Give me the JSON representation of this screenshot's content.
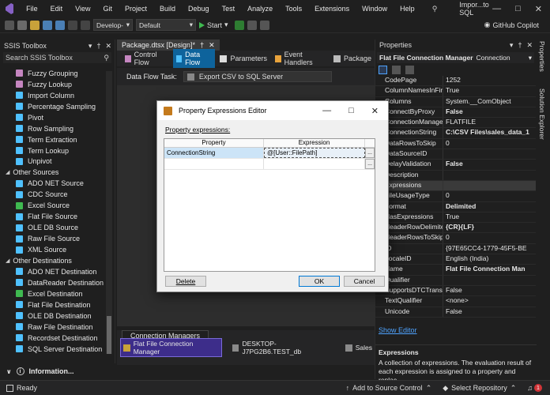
{
  "menu": [
    "File",
    "Edit",
    "View",
    "Git",
    "Project",
    "Build",
    "Debug",
    "Test",
    "Analyze",
    "Tools",
    "Extensions",
    "Window",
    "Help"
  ],
  "window_title": "Impor...to SQL",
  "toolbar": {
    "config": "Develop‑",
    "platform": "Default",
    "start": "Start",
    "copilot": "GitHub Copilot"
  },
  "toolbox": {
    "title": "SSIS Toolbox",
    "search": "Search SSIS Toolbox",
    "top_items": [
      {
        "label": "Fuzzy Grouping",
        "color": "#c586c0"
      },
      {
        "label": "Fuzzy Lookup",
        "color": "#c586c0"
      },
      {
        "label": "Import Column",
        "color": "#4fc1ff"
      },
      {
        "label": "Percentage Sampling",
        "color": "#4fc1ff"
      },
      {
        "label": "Pivot",
        "color": "#4fc1ff"
      },
      {
        "label": "Row Sampling",
        "color": "#4fc1ff"
      },
      {
        "label": "Term Extraction",
        "color": "#4fc1ff"
      },
      {
        "label": "Term Lookup",
        "color": "#4fc1ff"
      },
      {
        "label": "Unpivot",
        "color": "#4fc1ff"
      }
    ],
    "sources_header": "Other Sources",
    "sources": [
      {
        "label": "ADO NET Source",
        "color": "#4fc1ff"
      },
      {
        "label": "CDC Source",
        "color": "#4fc1ff"
      },
      {
        "label": "Excel Source",
        "color": "#3fb950"
      },
      {
        "label": "Flat File Source",
        "color": "#4fc1ff"
      },
      {
        "label": "OLE DB Source",
        "color": "#4fc1ff"
      },
      {
        "label": "Raw File Source",
        "color": "#4fc1ff"
      },
      {
        "label": "XML Source",
        "color": "#4fc1ff"
      }
    ],
    "dest_header": "Other Destinations",
    "destinations": [
      {
        "label": "ADO NET Destination",
        "color": "#4fc1ff"
      },
      {
        "label": "DataReader Destination",
        "color": "#4fc1ff"
      },
      {
        "label": "Excel Destination",
        "color": "#3fb950"
      },
      {
        "label": "Flat File Destination",
        "color": "#4fc1ff"
      },
      {
        "label": "OLE DB Destination",
        "color": "#4fc1ff"
      },
      {
        "label": "Raw File Destination",
        "color": "#4fc1ff"
      },
      {
        "label": "Recordset Destination",
        "color": "#4fc1ff"
      },
      {
        "label": "SQL Server Destination",
        "color": "#4fc1ff"
      }
    ],
    "info": "Information..."
  },
  "designer": {
    "doc_tab": "Package.dtsx [Design]*",
    "tabs": [
      {
        "label": "Control Flow",
        "active": false
      },
      {
        "label": "Data Flow",
        "active": true
      },
      {
        "label": "Parameters",
        "active": false
      },
      {
        "label": "Event Handlers",
        "active": false
      },
      {
        "label": "Package",
        "active": false
      }
    ],
    "task_label": "Data Flow Task:",
    "task_value": "Export CSV to SQL Server",
    "conn_tab": "Connection Managers",
    "conns": [
      {
        "label": "Flat File Connection Manager",
        "selected": true
      },
      {
        "label": "DESKTOP-J7PG2B6.TEST_db",
        "selected": false
      },
      {
        "label": "Sales",
        "selected": false
      }
    ]
  },
  "properties": {
    "title": "Properties",
    "object_name": "Flat File Connection Manager",
    "object_type": "Connection",
    "rows": [
      {
        "name": "CodePage",
        "value": "1252",
        "bold": false
      },
      {
        "name": "ColumnNamesInFirstD",
        "value": "True",
        "bold": false
      },
      {
        "name": "Columns",
        "value": "System.__ComObject",
        "bold": false
      },
      {
        "name": "ConnectByProxy",
        "value": "False",
        "bold": true
      },
      {
        "name": "ConnectionManagerTy",
        "value": "FLATFILE",
        "bold": false
      },
      {
        "name": "ConnectionString",
        "value": "C:\\CSV Files\\sales_data_1",
        "bold": true
      },
      {
        "name": "DataRowsToSkip",
        "value": "0",
        "bold": false
      },
      {
        "name": "DataSourceID",
        "value": "",
        "bold": false
      },
      {
        "name": "DelayValidation",
        "value": "False",
        "bold": true
      },
      {
        "name": "Description",
        "value": "",
        "bold": false
      },
      {
        "name": "Expressions",
        "value": "",
        "bold": false
      },
      {
        "name": "FileUsageType",
        "value": "0",
        "bold": false
      },
      {
        "name": "Format",
        "value": "Delimited",
        "bold": true
      },
      {
        "name": "HasExpressions",
        "value": "True",
        "bold": false
      },
      {
        "name": "HeaderRowDelimiter",
        "value": "{CR}{LF}",
        "bold": true
      },
      {
        "name": "HeaderRowsToSkip",
        "value": "0",
        "bold": false
      },
      {
        "name": "ID",
        "value": "{97E65CC4-1779-45F5-BE",
        "bold": false
      },
      {
        "name": "LocaleID",
        "value": "English (India)",
        "bold": false
      },
      {
        "name": "Name",
        "value": "Flat File Connection Man",
        "bold": true
      },
      {
        "name": "Qualifier",
        "value": "",
        "bold": false
      },
      {
        "name": "SupportsDTCTransactio",
        "value": "False",
        "bold": false
      },
      {
        "name": "TextQualifier",
        "value": "<none>",
        "bold": false
      },
      {
        "name": "Unicode",
        "value": "False",
        "bold": false
      }
    ],
    "show_editor": "Show Editor",
    "desc_title": "Expressions",
    "desc_text": "A collection of expressions. The evaluation result of each expression is assigned to a property and replac..."
  },
  "rail": {
    "properties": "Properties",
    "solution_explorer": "Solution Explorer"
  },
  "dialog": {
    "title": "Property Expressions Editor",
    "label": "Property expressions:",
    "col_property": "Property",
    "col_expression": "Expression",
    "row_property": "ConnectionString",
    "row_expression": "@[User::FilePath]",
    "ellipsis": "...",
    "delete": "Delete",
    "ok": "OK",
    "cancel": "Cancel"
  },
  "status": {
    "ready": "Ready",
    "source_control": "Add to Source Control",
    "repository": "Select Repository",
    "notifications": "1"
  }
}
